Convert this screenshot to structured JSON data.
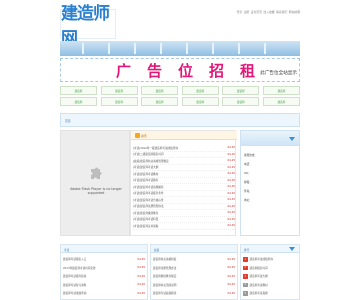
{
  "site": {
    "logo_text": "建造师网"
  },
  "toplinks": [
    "登录",
    "注册",
    "设为首页",
    "加入收藏",
    "联系我们",
    "网站地图"
  ],
  "ad": {
    "title": "广告位招租",
    "note": "此广告位全站显示"
  },
  "links_row_1": [
    "建造师",
    "建造师",
    "建造师",
    "建造师",
    "建造师",
    "建造师"
  ],
  "links_row_2": [
    "建造师",
    "建造师",
    "建造师",
    "建造师",
    "建造师",
    "建造师"
  ],
  "breadcrumb": "首页",
  "player": {
    "message": "Adobe Flash Player is no longer supported"
  },
  "news": {
    "title": "资讯",
    "items": [
      {
        "text": "[考试]2012年一级建造师考试成绩查询",
        "date": "04-25"
      },
      {
        "text": "[考试]二级建造师报名时间",
        "date": "04-25"
      },
      {
        "text": "[政策]建造师执业资格管理规定",
        "date": "04-25"
      },
      {
        "text": "[考试]建造师考试大纲",
        "date": "04-25"
      },
      {
        "text": "[考试]建造师考试教材",
        "date": "04-25"
      },
      {
        "text": "[考试]建造师考试题库",
        "date": "04-25"
      },
      {
        "text": "[考试]建造师考试真题解析",
        "date": "04-25"
      },
      {
        "text": "[考试]建造师考试报考条件",
        "date": "04-25"
      },
      {
        "text": "[考试]建造师考试合格标准",
        "date": "04-25"
      },
      {
        "text": "[考试]建造师注册管理办法",
        "date": "04-25"
      },
      {
        "text": "[考试]建造师继续教育",
        "date": "04-25"
      },
      {
        "text": "[考试]建造师考试科目",
        "date": "04-25"
      },
      {
        "text": "[考试]建造师证书领取",
        "date": "04-25"
      }
    ]
  },
  "sidebar": {
    "items": [
      {
        "label": "客服热线：",
        "value": ""
      },
      {
        "label": "电话：",
        "value": ""
      },
      {
        "label": "QQ：",
        "value": ""
      },
      {
        "label": "邮箱：",
        "value": ""
      },
      {
        "label": "传真：",
        "value": ""
      },
      {
        "label": "地址：",
        "value": ""
      }
    ]
  },
  "panel_left": {
    "title": "考试",
    "items": [
      {
        "text": "建造师考试报名入口",
        "date": "04-25"
      },
      {
        "text": "2013年建造师考试时间安排",
        "date": "04-25"
      },
      {
        "text": "建造师考试报考指南",
        "date": "04-25"
      },
      {
        "text": "建造师考试复习资料",
        "date": "04-25"
      },
      {
        "text": "建造师考试成绩查询",
        "date": "04-25"
      }
    ]
  },
  "panel_mid": {
    "title": "政策",
    "items": [
      {
        "text": "建造师执业资格制度",
        "date": "04-25"
      },
      {
        "text": "建造师注册管理办法",
        "date": "04-25"
      },
      {
        "text": "建造师继续教育规定",
        "date": "04-25"
      },
      {
        "text": "建造师执业范围说明",
        "date": "04-25"
      },
      {
        "text": "建造师考试政策解读",
        "date": "04-25"
      }
    ]
  },
  "panel_side": {
    "title": "排行",
    "items": [
      {
        "rank": "1",
        "text": "建造师考试成绩查询"
      },
      {
        "rank": "2",
        "text": "建造师报名时间"
      },
      {
        "rank": "3",
        "text": "建造师考试大纲"
      },
      {
        "rank": "4",
        "text": "建造师考试教材"
      },
      {
        "rank": "5",
        "text": "建造师考试真题"
      }
    ]
  }
}
